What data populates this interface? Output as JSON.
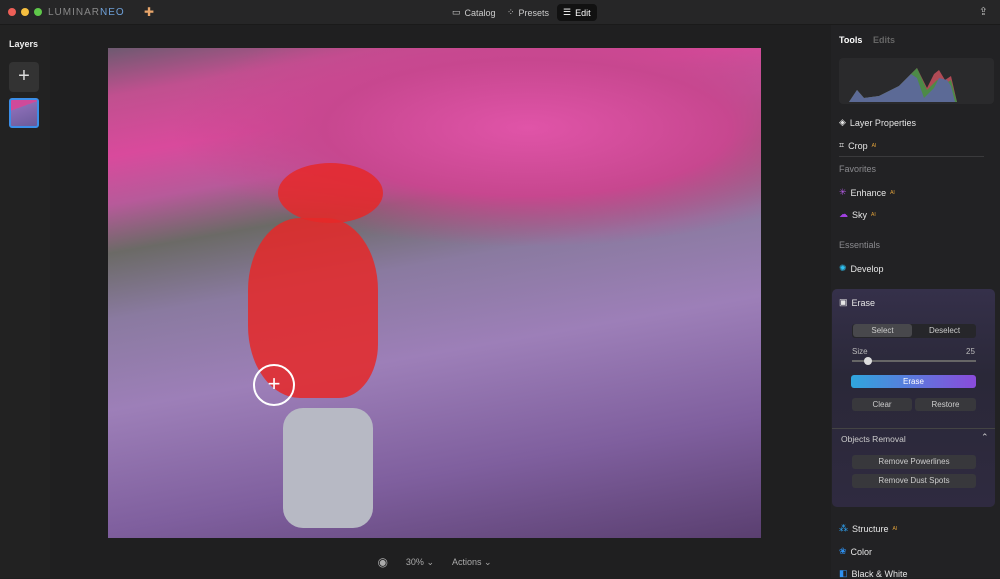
{
  "app": {
    "brand": "LUMINAR",
    "brand_accent": "NEO"
  },
  "nav": [
    {
      "label": "Catalog",
      "icon": "folder-icon"
    },
    {
      "label": "Presets",
      "icon": "presets-icon"
    },
    {
      "label": "Edit",
      "icon": "sliders-icon",
      "active": true
    }
  ],
  "layers": {
    "title": "Layers",
    "add": "+"
  },
  "bottom": {
    "zoom": "30%",
    "actions": "Actions"
  },
  "right": {
    "tabs": [
      "Tools",
      "Edits"
    ],
    "items": {
      "layer_properties": "Layer Properties",
      "crop": "Crop",
      "enhance": "Enhance",
      "sky": "Sky",
      "develop": "Develop",
      "structure": "Structure",
      "color": "Color",
      "bw": "Black & White"
    },
    "ai_badge": "AI",
    "sections": {
      "favorites": "Favorites",
      "essentials": "Essentials"
    },
    "erase": {
      "title": "Erase",
      "select": "Select",
      "deselect": "Deselect",
      "size_label": "Size",
      "size_value": "25",
      "size_fraction": 0.1,
      "erase": "Erase",
      "clear": "Clear",
      "restore": "Restore",
      "objects_removal": "Objects Removal",
      "remove_powerlines": "Remove Powerlines",
      "remove_dust": "Remove Dust Spots"
    }
  },
  "colors": {
    "accent": "#3b8ee8",
    "mask": "#e62828",
    "ai": "#e2a23a"
  }
}
